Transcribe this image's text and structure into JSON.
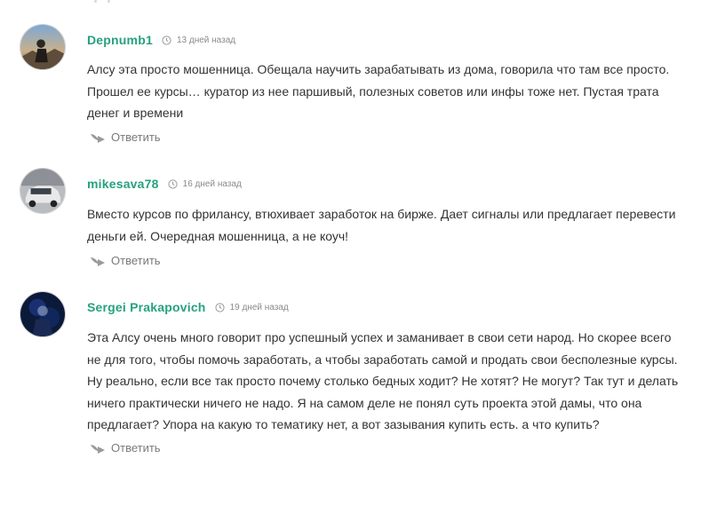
{
  "comments": [
    {
      "author": "Depnumb1",
      "time": "13 дней назад",
      "text": "Алсу эта просто мошенница. Обещала научить зарабатывать из дома, говорила что там все просто. Прошел ее курсы… куратор из нее паршивый, полезных советов или инфы тоже нет. Пустая трата денег и времени",
      "reply_label": "Ответить",
      "reply_icon": "reply-arrow-icon",
      "clock_icon": "clock-icon"
    },
    {
      "author": "mikesava78",
      "time": "16 дней назад",
      "text": "Вместо курсов по фрилансу, втюхивает заработок на бирже. Дает сигналы или предлагает перевести деньги ей. Очередная мошенница, а не коуч!",
      "reply_label": "Ответить",
      "reply_icon": "reply-arrow-icon",
      "clock_icon": "clock-icon"
    },
    {
      "author": "Sergei Prakapovich",
      "time": "19 дней назад",
      "text": "Эта Алсу очень много говорит про успешный успех и заманивает в свои сети народ. Но скорее всего не для того, чтобы помочь заработать, а чтобы заработать самой и продать свои бесполезные курсы. Ну реально, если все так просто почему столько бедных ходит? Не хотят? Не могут? Так тут и делать ничего практически ничего не надо. Я на самом деле не понял суть проекта этой дамы, что она предлагает? Упора на какую то тематику нет, а вот зазывания купить есть. а что купить?",
      "reply_label": "Ответить",
      "reply_icon": "reply-arrow-icon",
      "clock_icon": "clock-icon"
    }
  ],
  "colors": {
    "author": "#26a17f",
    "text": "#333333",
    "meta": "#8a8a8a",
    "reply": "#7a7a7a"
  }
}
